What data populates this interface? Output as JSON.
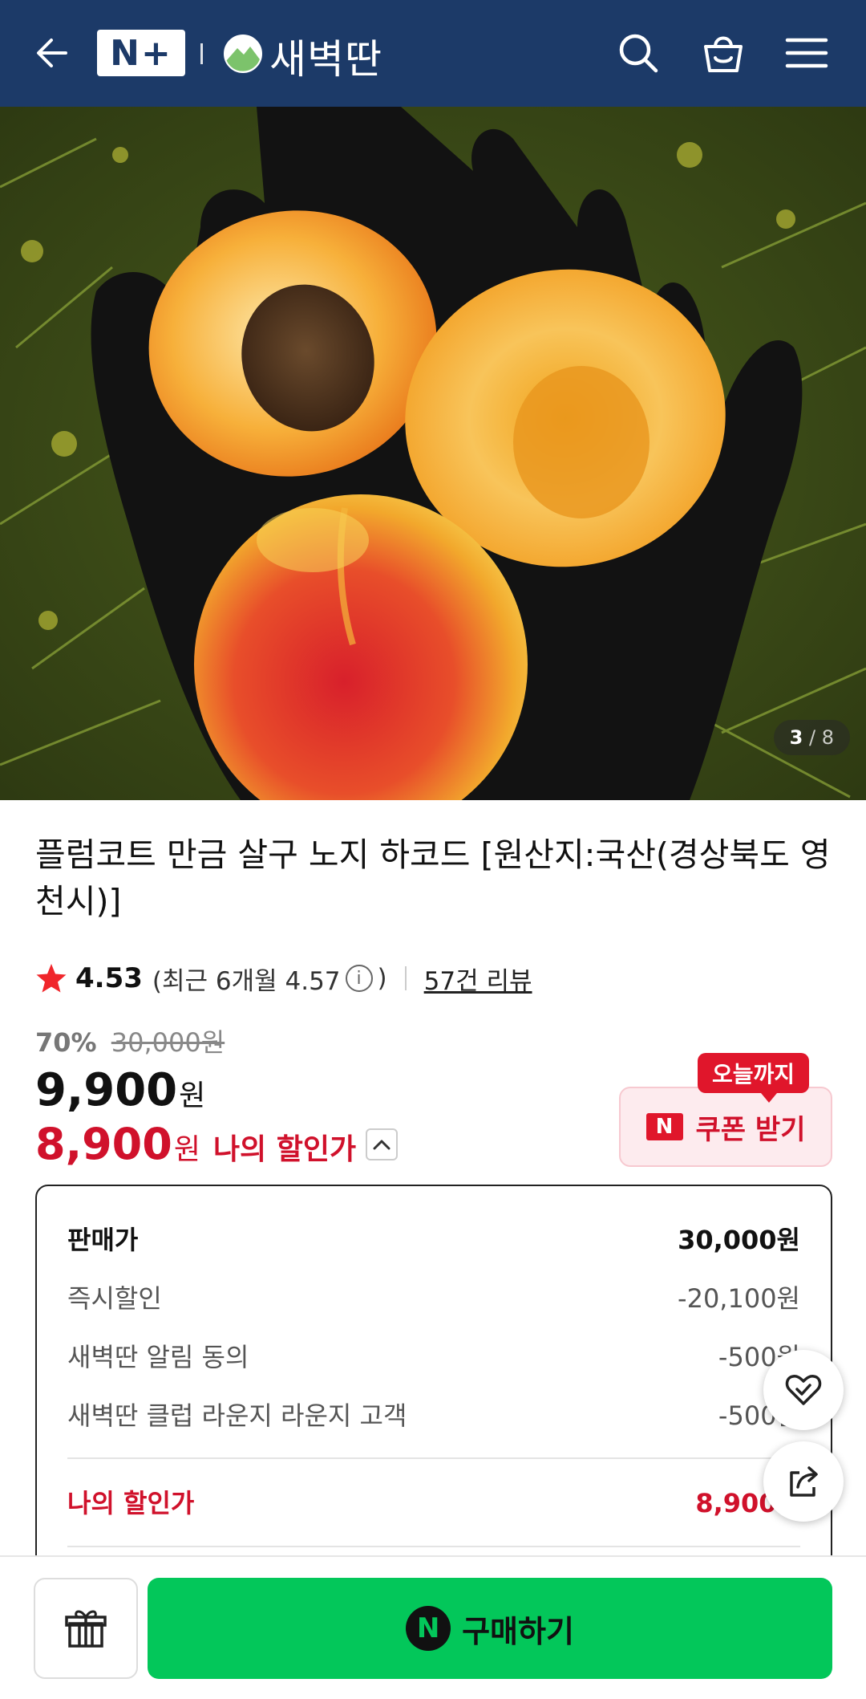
{
  "header": {
    "logo_text": "N+",
    "brand_name": "새벽딴",
    "bg_color": "#1c3a68"
  },
  "hero": {
    "image_desc": "apricot-fruits-in-black-glove",
    "counter_current": "3",
    "counter_sep": " / ",
    "counter_total": "8"
  },
  "product": {
    "title": "플럼코트 만금 살구 노지 하코드 [원산지:국산(경상북도 영천시)]",
    "rating": {
      "score": "4.53",
      "recent_prefix": "(최근 6개월 4.57",
      "recent_suffix": ")",
      "info_glyph": "i",
      "reviews": "57건 리뷰"
    },
    "price": {
      "discount_pct": "70%",
      "original": "30,000원",
      "sale": "9,900",
      "sale_unit": "원",
      "my_price": "8,900",
      "my_price_unit": "원",
      "my_price_label": "나의 할인가"
    },
    "coupon": {
      "tag": "오늘까지",
      "badge": "N",
      "label": "쿠폰 받기"
    }
  },
  "breakdown": {
    "rows": [
      {
        "label": "판매가",
        "value": "30,000원"
      },
      {
        "label": "즉시할인",
        "value": "-20,100원"
      },
      {
        "label": "새벽딴 알림 동의",
        "value": "-500원"
      },
      {
        "label": "새벽딴 클럽 라운지 라운지 고객",
        "value": "-500원"
      }
    ],
    "total_label": "나의 할인가",
    "total_value": "8,900원"
  },
  "bottom": {
    "buy_badge": "N",
    "buy_label": "구매하기",
    "buy_color": "#03c75a"
  },
  "colors": {
    "accent_red": "#d0112b",
    "header_navy": "#1c3a68",
    "naver_green": "#03c75a"
  }
}
